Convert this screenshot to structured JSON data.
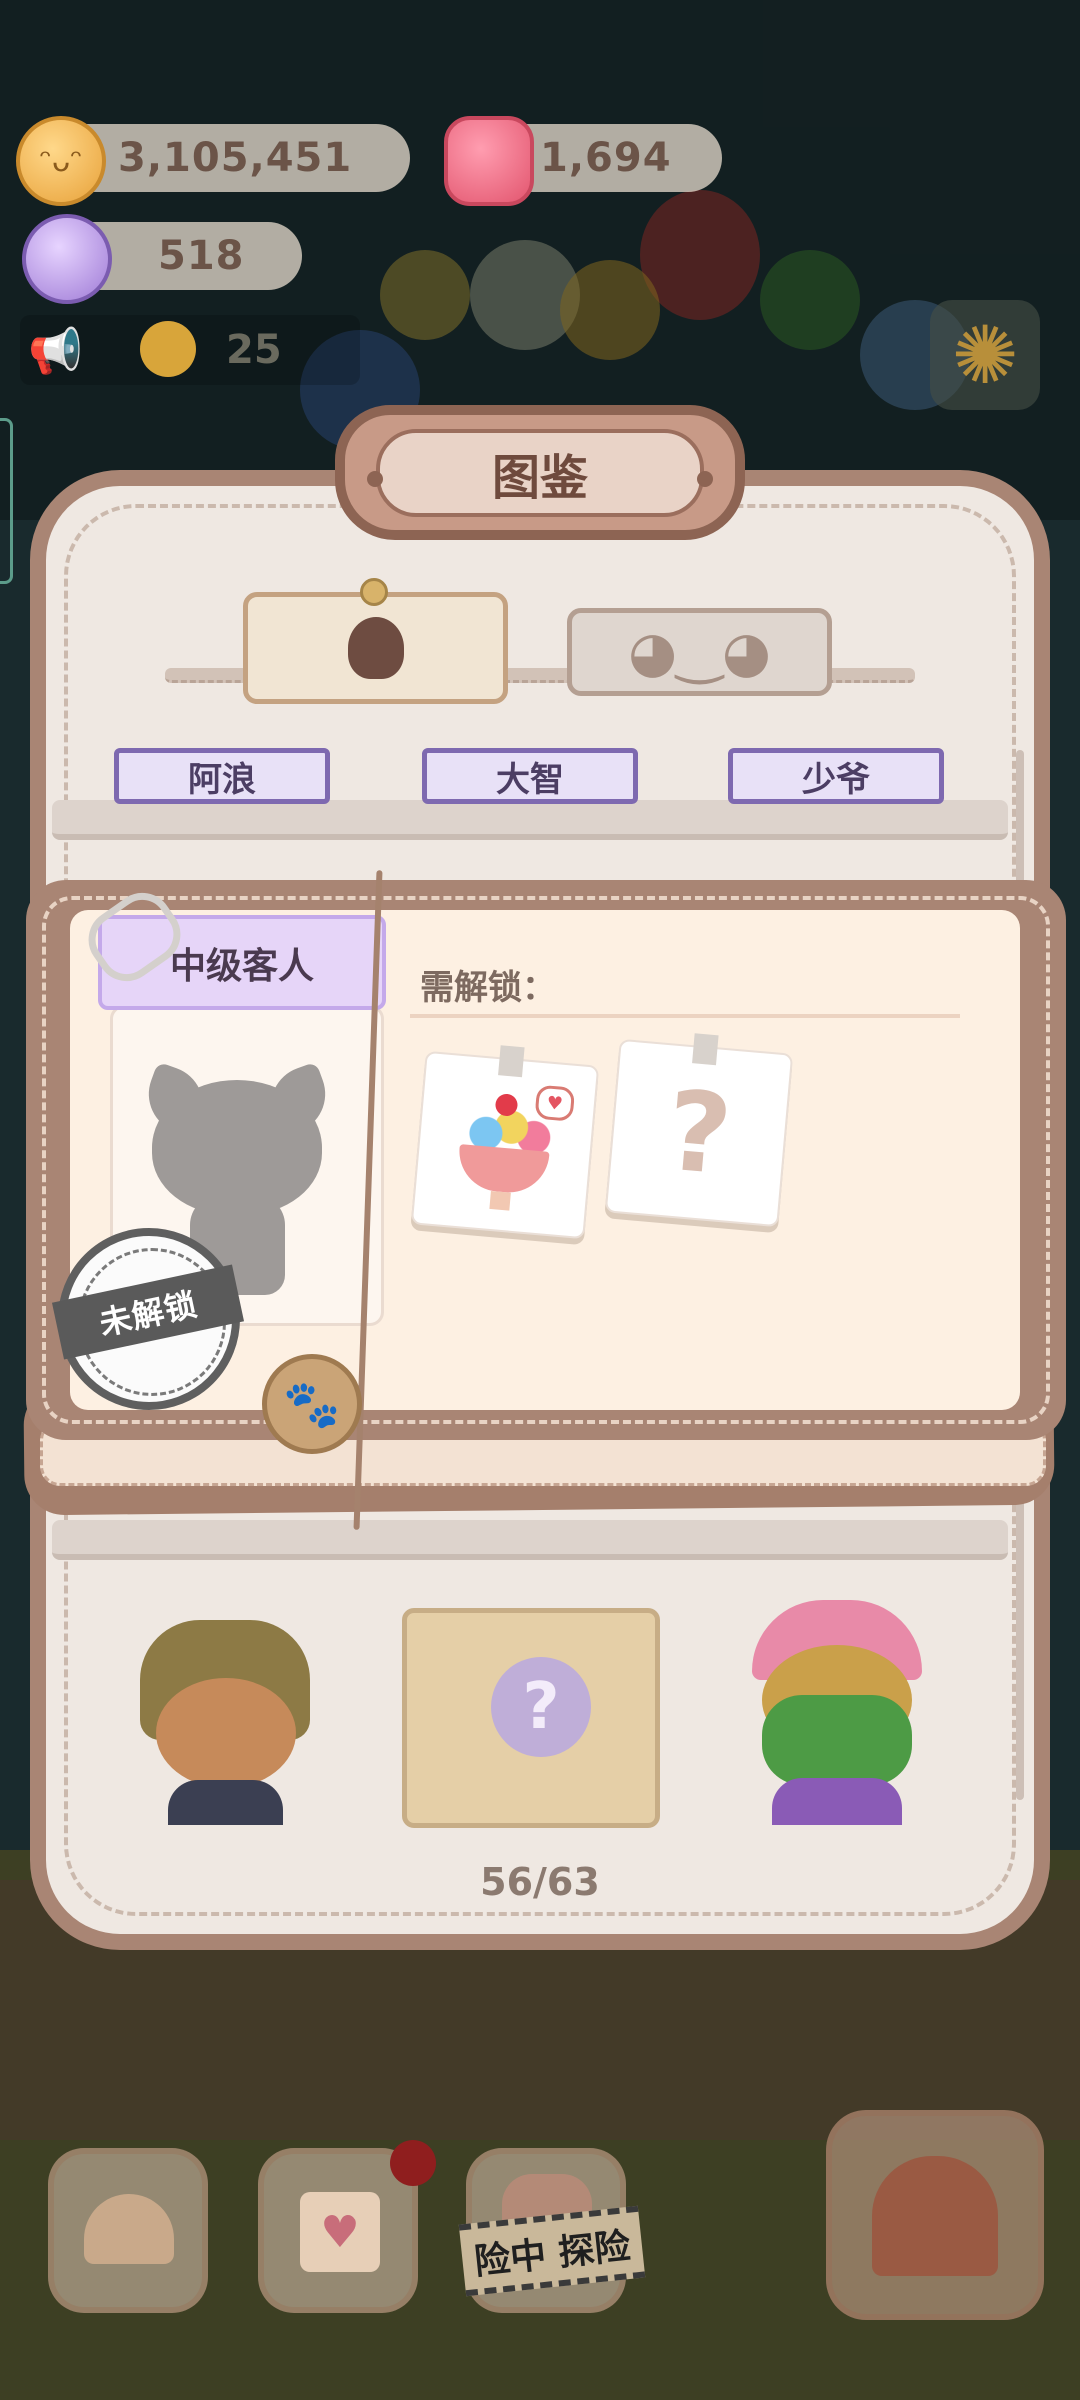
{
  "hud": {
    "coins": "3,105,451",
    "gems": "1,694",
    "candy": "518",
    "ticket_count": "25",
    "coin_icon": "cookie-coin-icon",
    "gem_icon": "pink-gem-icon",
    "candy_icon": "candy-icon",
    "ticket_icon": "duck-ticket-icon",
    "settings_icon": "gear-icon"
  },
  "modal": {
    "title": "图鉴",
    "tabs": [
      {
        "icon": "chef-skull-icon",
        "active": true
      },
      {
        "icon": "duck-face-icon",
        "active": false
      }
    ],
    "top_row_names": [
      "阿浪",
      "大智",
      "少爷"
    ],
    "detail": {
      "rank": "中级客人",
      "status_stamp": "未解锁",
      "requirement_label": "需解锁：",
      "requirements": [
        {
          "icon": "ice-cream-sundae-icon",
          "known": true
        },
        {
          "icon": "question-mark-icon",
          "known": false,
          "text": "?"
        }
      ]
    },
    "bottom_row": [
      {
        "name": "bear-explorer",
        "locked": false
      },
      {
        "name": "mystery-gift",
        "locked": true,
        "text": "?"
      },
      {
        "name": "crocodile-cap",
        "locked": false
      }
    ],
    "progress": "56/63"
  },
  "bottom_nav": {
    "items": [
      "hotel-icon",
      "diary-icon",
      "adventure-icon",
      "theater-icon"
    ],
    "adventure_label": "险中 探险",
    "has_notification": true
  },
  "colors": {
    "modal_border": "#a98574",
    "modal_bg": "#efe8e2",
    "rank_bg": "#e6d5f8",
    "name_plate_border": "#7e69b0"
  }
}
